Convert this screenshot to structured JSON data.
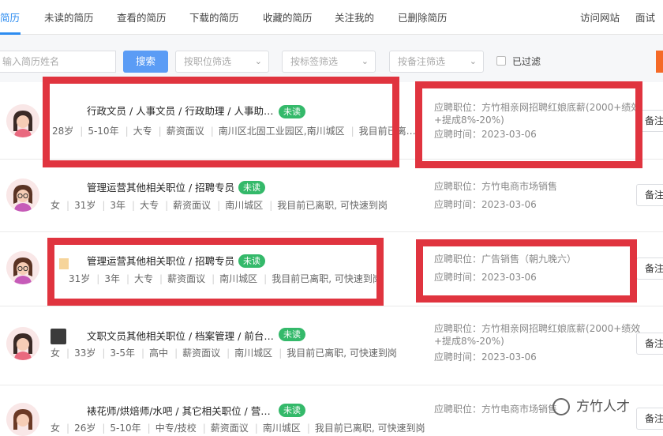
{
  "tabs": [
    {
      "label": "简历"
    },
    {
      "label": "未读的简历"
    },
    {
      "label": "查看的简历"
    },
    {
      "label": "下载的简历"
    },
    {
      "label": "收藏的简历"
    },
    {
      "label": "关注我的"
    },
    {
      "label": "已删除简历"
    }
  ],
  "header_links": {
    "visit": "访问网站",
    "interview": "面试"
  },
  "filters": {
    "search_placeholder": "输入简历姓名",
    "search_button": "搜索",
    "position_filter": "按职位筛选",
    "tag_filter": "按标签筛选",
    "note_filter": "按备注筛选",
    "filtered_label": "已过滤"
  },
  "colors": {
    "accent": "#2d8cf0",
    "badge": "#34b96a",
    "highlight": "#e0343f"
  },
  "rows": [
    {
      "title": "行政文员 / 人事文员 / 行政助理 / 人事助…",
      "badge": "未读",
      "meta": [
        "28岁",
        "5-10年",
        "大专",
        "薪资面议",
        "南川区北固工业园区,南川城区",
        "我目前已离…"
      ],
      "gender": "",
      "applied_position_label": "应聘职位：",
      "applied_position": "方竹相亲网招聘红娘底薪(2000+绩效+提成8%-20%)",
      "applied_time_label": "应聘时间：",
      "applied_time": "2023-03-06",
      "note": "备注"
    },
    {
      "title": "管理运营其他相关职位 / 招聘专员",
      "badge": "未读",
      "meta": [
        "31岁",
        "3年",
        "大专",
        "薪资面议",
        "南川城区",
        "我目前已离职, 可快速到岗"
      ],
      "gender": "女",
      "applied_position_label": "应聘职位：",
      "applied_position": "方竹电商市场销售",
      "applied_time_label": "应聘时间：",
      "applied_time": "2023-03-06",
      "note": "备注"
    },
    {
      "title": "管理运营其他相关职位 / 招聘专员",
      "badge": "未读",
      "meta": [
        "31岁",
        "3年",
        "大专",
        "薪资面议",
        "南川城区",
        "我目前已离职, 可快速到岗"
      ],
      "gender": "",
      "applied_position_label": "应聘职位：",
      "applied_position": "广告销售（朝九晚六）",
      "applied_time_label": "应聘时间：",
      "applied_time": "2023-03-06",
      "note": "备注"
    },
    {
      "title": "文职文员其他相关职位 / 档案管理 / 前台…",
      "badge": "未读",
      "meta": [
        "33岁",
        "3-5年",
        "高中",
        "薪资面议",
        "南川城区",
        "我目前已离职, 可快速到岗"
      ],
      "gender": "女",
      "applied_position_label": "应聘职位：",
      "applied_position": "方竹相亲网招聘红娘底薪(2000+绩效+提成8%-20%)",
      "applied_time_label": "应聘时间：",
      "applied_time": "2023-03-06",
      "note": "备注"
    },
    {
      "title": "裱花师/烘焙师/水吧 / 其它相关职位 / 营…",
      "badge": "未读",
      "meta": [
        "26岁",
        "5-10年",
        "中专/技校",
        "薪资面议",
        "南川城区",
        "我目前已离职, 可快速到岗"
      ],
      "gender": "女",
      "applied_position_label": "应聘职位：",
      "applied_position": "方竹电商市场销售",
      "applied_time_label": "",
      "applied_time": "",
      "note": "备注"
    }
  ],
  "watermark": "方竹人才"
}
